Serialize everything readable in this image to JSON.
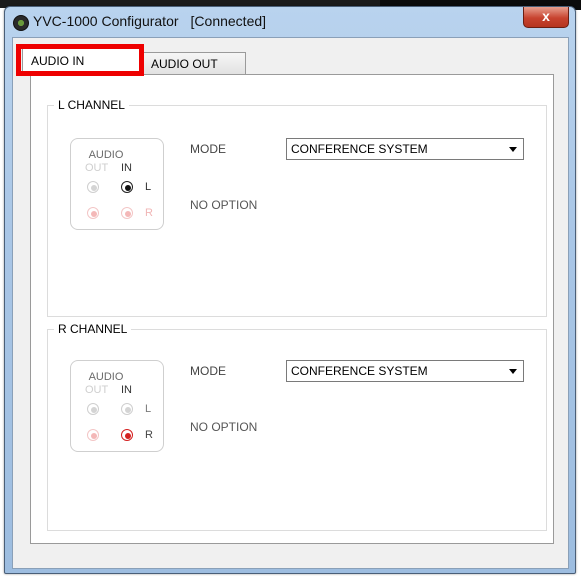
{
  "window": {
    "title": "YVC-1000 Configurator",
    "status": "[Connected]",
    "close_label": "x"
  },
  "tabs": [
    {
      "label": "AUDIO IN",
      "active": true
    },
    {
      "label": "AUDIO OUT",
      "active": false
    }
  ],
  "highlight_color": "#ee0000",
  "l_channel": {
    "title": "L CHANNEL",
    "audio_label": "AUDIO",
    "out_label": "OUT",
    "in_label": "IN",
    "row_l": "L",
    "row_r": "R",
    "mode_label": "MODE",
    "mode_value": "CONFERENCE SYSTEM",
    "option_text": "NO OPTION"
  },
  "r_channel": {
    "title": "R CHANNEL",
    "audio_label": "AUDIO",
    "out_label": "OUT",
    "in_label": "IN",
    "row_l": "L",
    "row_r": "R",
    "mode_label": "MODE",
    "mode_value": "CONFERENCE SYSTEM",
    "option_text": "NO OPTION"
  },
  "icons": {
    "app": "app-gear-icon",
    "close": "close-icon",
    "dropdown": "chevron-down-icon"
  }
}
